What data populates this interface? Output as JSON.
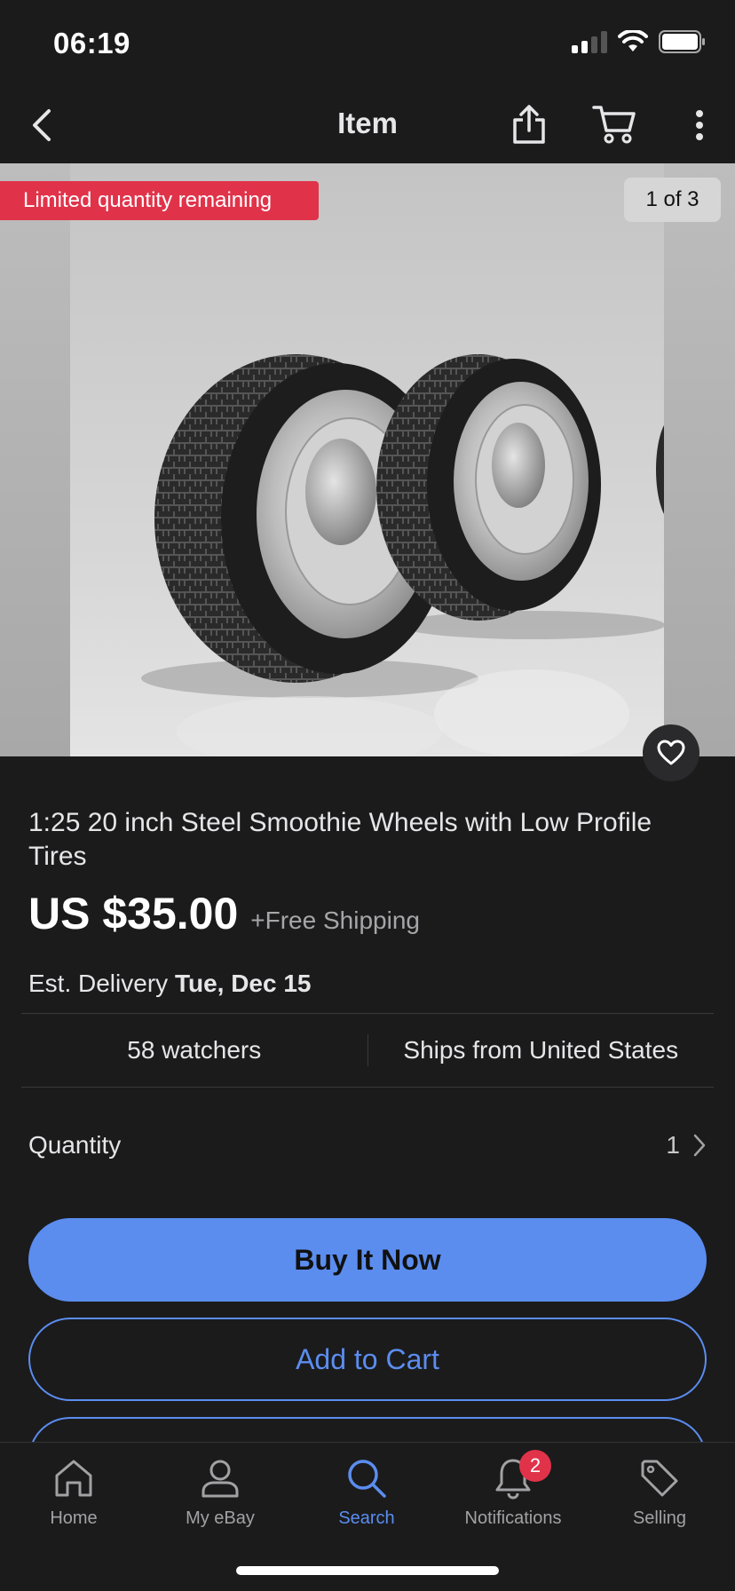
{
  "status_bar": {
    "time": "06:19"
  },
  "nav": {
    "title": "Item",
    "back_icon": "chevron-left-icon",
    "share_icon": "share-icon",
    "cart_icon": "cart-icon",
    "more_icon": "more-vertical-icon"
  },
  "gallery": {
    "limited_badge": "Limited quantity remaining",
    "counter": "1 of 3",
    "watch_icon": "heart-icon",
    "colors": {
      "badge_red": "#e0334a"
    }
  },
  "item": {
    "title": "1:25 20 inch Steel Smoothie Wheels with Low Profile Tires",
    "price": "US $35.00",
    "shipping": "+Free Shipping",
    "delivery_label": "Est. Delivery",
    "delivery_date": "Tue, Dec 15",
    "watchers": "58 watchers",
    "ships_from": "Ships from United States",
    "quantity_label": "Quantity",
    "quantity_value": "1"
  },
  "actions": {
    "buy_now": "Buy It Now",
    "add_to_cart": "Add to Cart",
    "accent_color": "#5b8def"
  },
  "tab_bar": {
    "tabs": [
      {
        "label": "Home",
        "icon": "home-icon"
      },
      {
        "label": "My eBay",
        "icon": "person-icon"
      },
      {
        "label": "Search",
        "icon": "search-icon",
        "active": true
      },
      {
        "label": "Notifications",
        "icon": "bell-icon",
        "badge": "2"
      },
      {
        "label": "Selling",
        "icon": "tag-icon"
      }
    ]
  }
}
